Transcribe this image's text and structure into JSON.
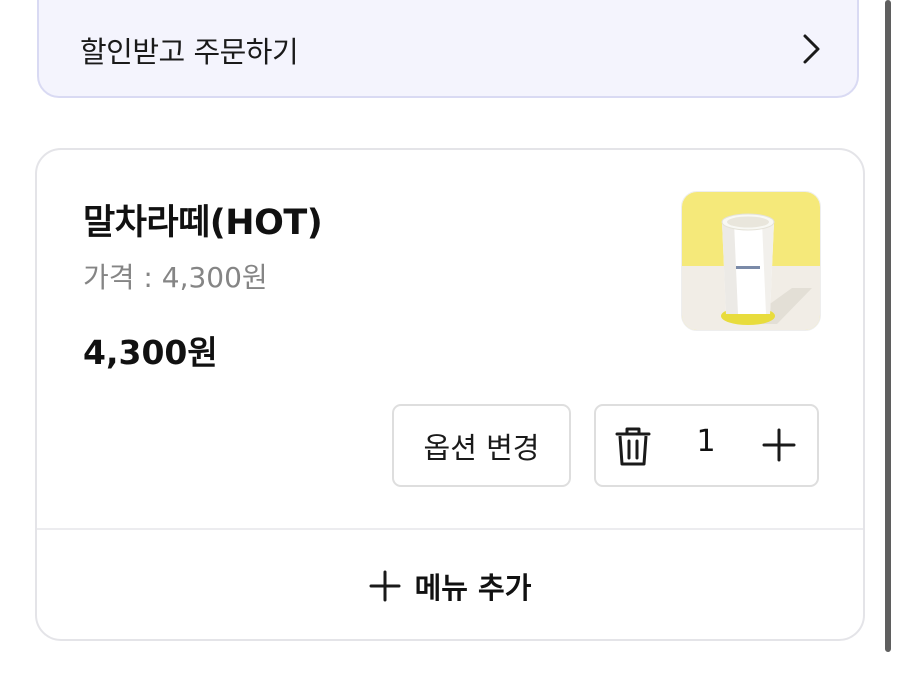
{
  "discount_banner": {
    "label": "할인받고 주문하기",
    "icon": "chevron-right-icon"
  },
  "cart_item": {
    "name": "말차라떼(HOT)",
    "price_line": "가격 : 4,300원",
    "total": "4,300원",
    "image": "matcha-latte-hot-cup",
    "option_change_label": "옵션 변경",
    "quantity": "1",
    "delete_icon": "trash-icon",
    "increment_icon": "plus-icon"
  },
  "add_menu": {
    "label": "메뉴 추가",
    "icon": "plus-icon"
  },
  "colors": {
    "banner_background": "#f4f4fd",
    "banner_border": "#d9daf3",
    "card_border": "#e4e4e8",
    "muted_text": "#858585",
    "image_yellow": "#f5e97a"
  }
}
